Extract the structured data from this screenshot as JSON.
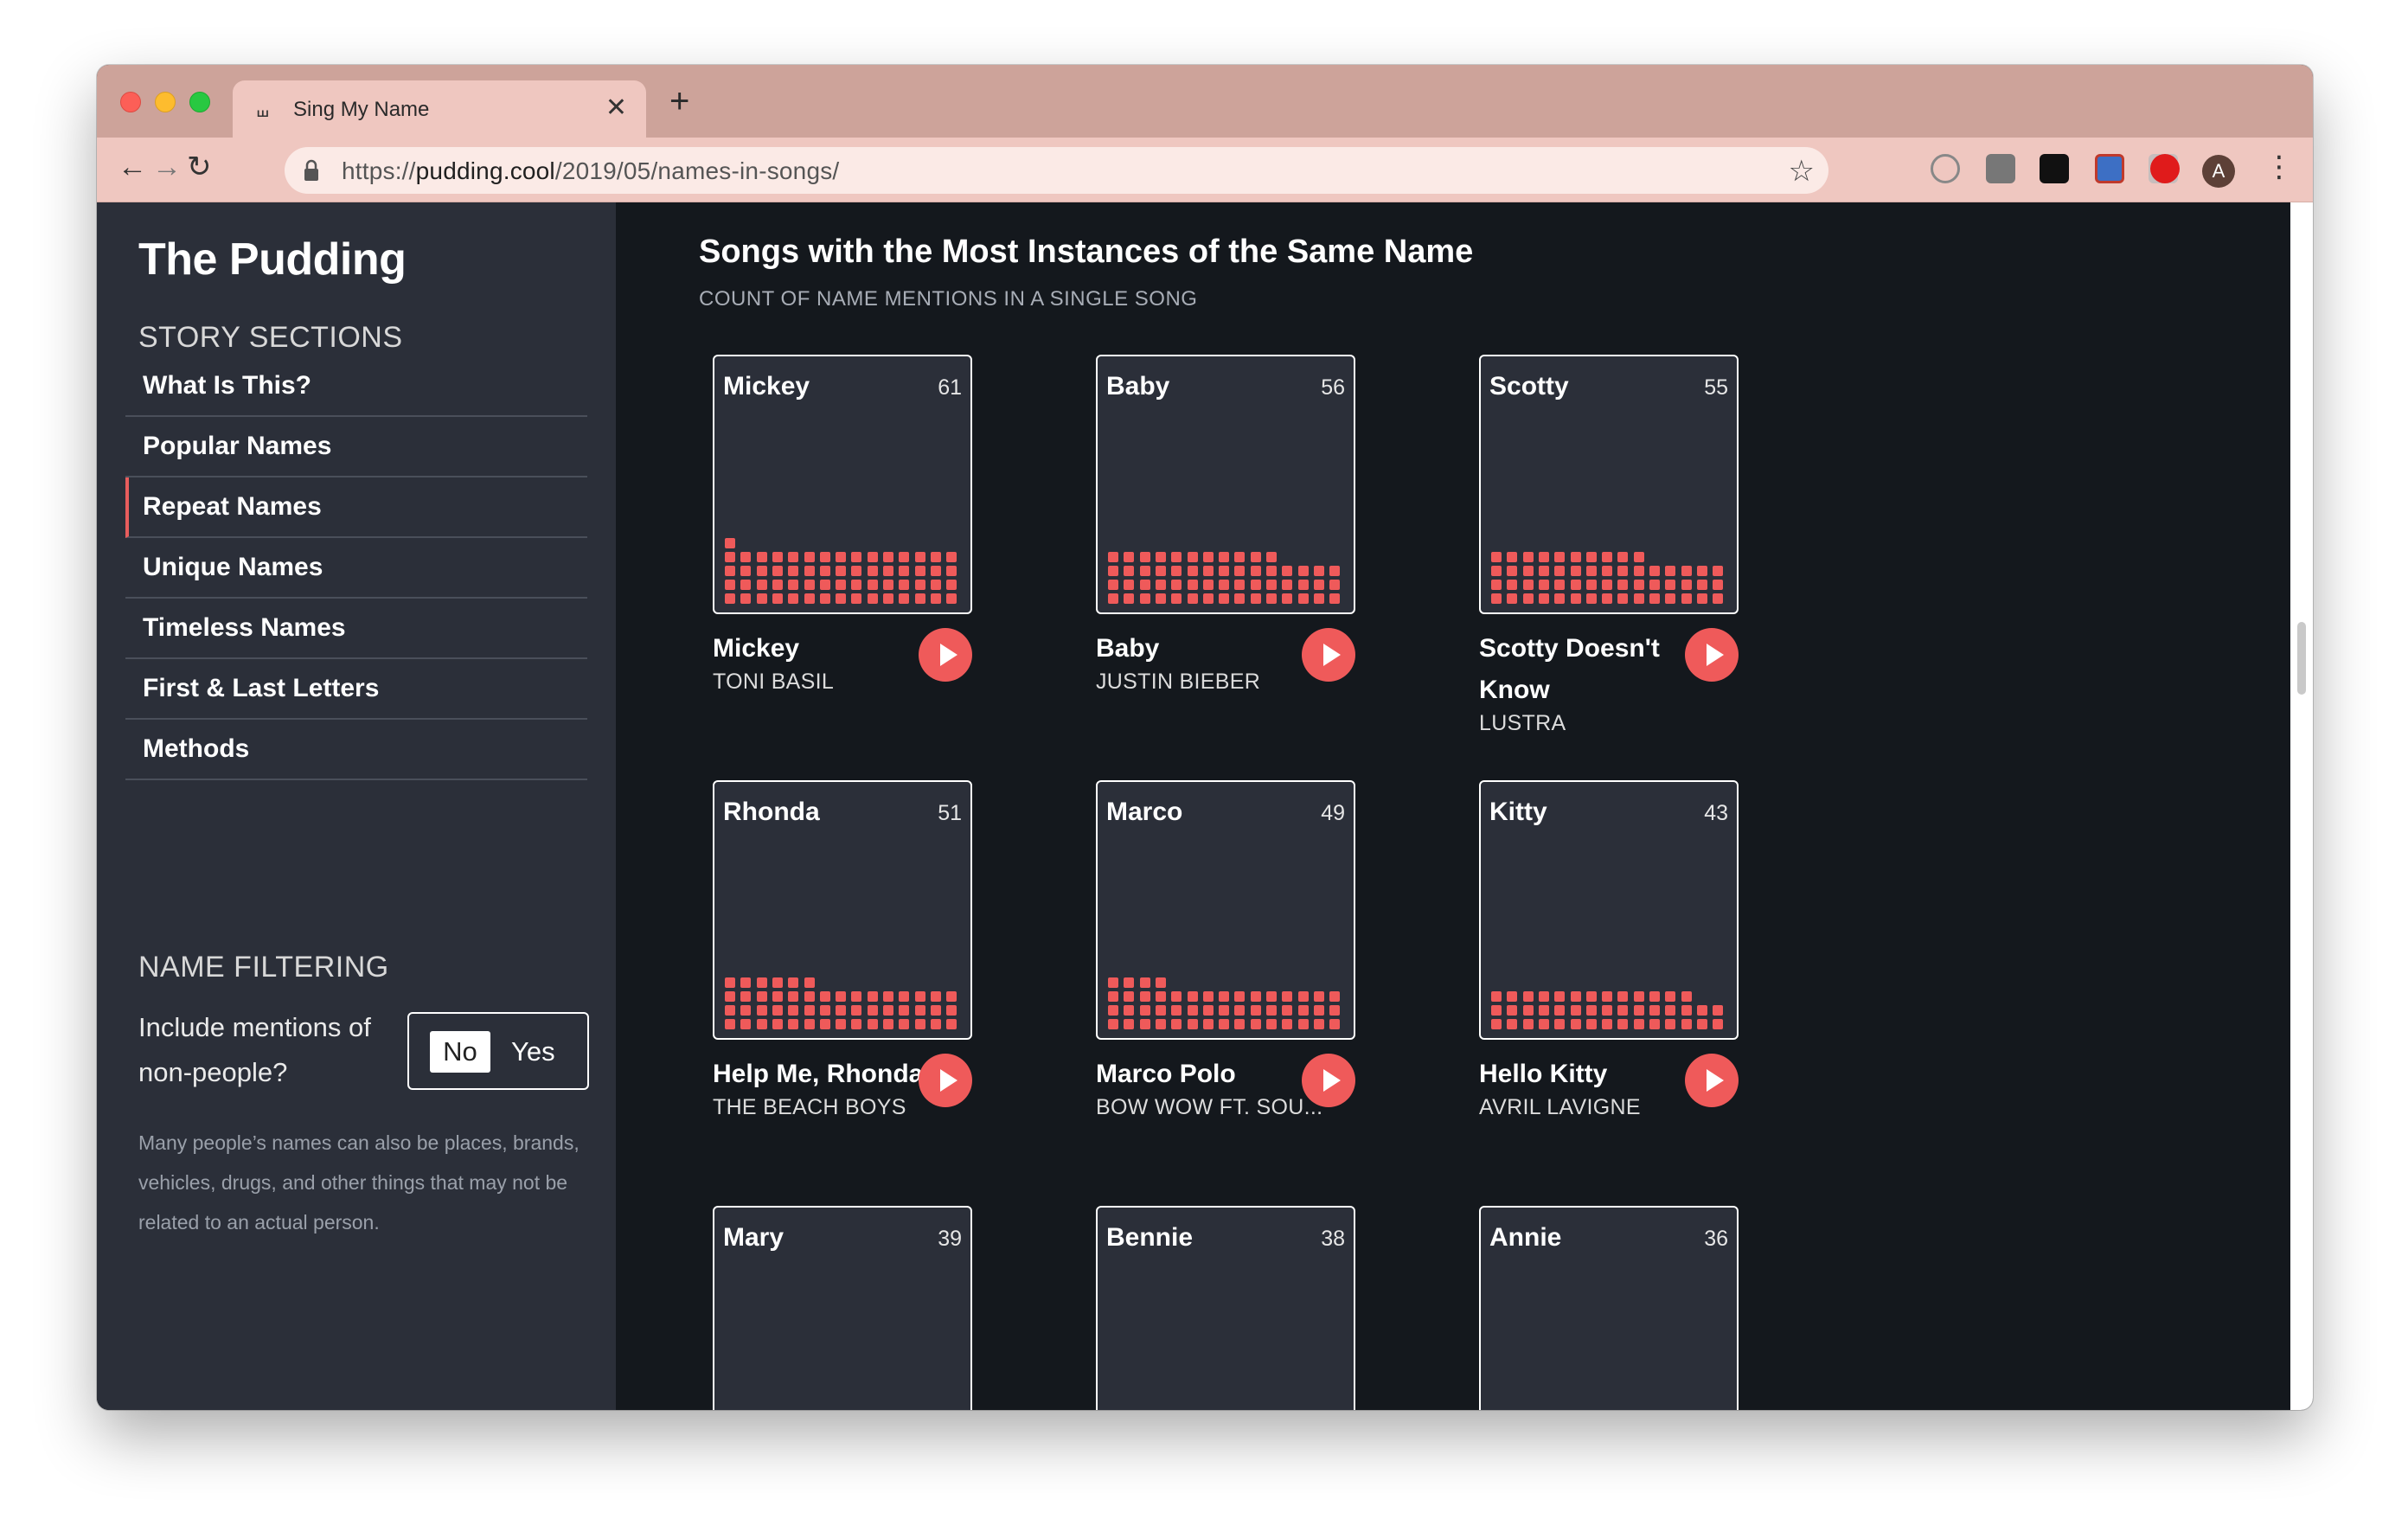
{
  "browser": {
    "tab_title": "Sing My Name",
    "url_scheme": "https://",
    "url_host": "pudding.cool",
    "url_path": "/2019/05/names-in-songs/",
    "avatar_letter": "A"
  },
  "sidebar": {
    "brand": "The Pudding",
    "sections_heading": "STORY SECTIONS",
    "items": [
      {
        "label": "What Is This?"
      },
      {
        "label": "Popular Names"
      },
      {
        "label": "Repeat Names"
      },
      {
        "label": "Unique Names"
      },
      {
        "label": "Timeless Names"
      },
      {
        "label": "First & Last Letters"
      },
      {
        "label": "Methods"
      }
    ],
    "filter_heading": "NAME FILTERING",
    "filter_question": "Include mentions of non-people?",
    "toggle_no": "No",
    "toggle_yes": "Yes",
    "filter_note": "Many people’s names can also be places, brands, vehicles, drugs, and other things that may not be related to an actual person."
  },
  "main": {
    "title": "Songs with the Most Instances of the Same Name",
    "subtitle": "COUNT OF NAME MENTIONS IN A SINGLE SONG",
    "cards": [
      {
        "name": "Mickey",
        "count": 61,
        "song": "Mickey",
        "artist": "TONI BASIL"
      },
      {
        "name": "Baby",
        "count": 56,
        "song": "Baby",
        "artist": "JUSTIN BIEBER"
      },
      {
        "name": "Scotty",
        "count": 55,
        "song": "Scotty Doesn't Know",
        "artist": "LUSTRA"
      },
      {
        "name": "Rhonda",
        "count": 51,
        "song": "Help Me, Rhonda",
        "artist": "THE BEACH BOYS"
      },
      {
        "name": "Marco",
        "count": 49,
        "song": "Marco Polo",
        "artist": "BOW WOW FT. SOU..."
      },
      {
        "name": "Kitty",
        "count": 43,
        "song": "Hello Kitty",
        "artist": "AVRIL LAVIGNE"
      },
      {
        "name": "Mary",
        "count": 39
      },
      {
        "name": "Bennie",
        "count": 38
      },
      {
        "name": "Annie",
        "count": 36
      }
    ]
  },
  "colors": {
    "accent": "#ef5a5a",
    "sidebar_bg": "#2b2f39",
    "page_bg": "#14181d",
    "chrome": "#efc7c0"
  }
}
